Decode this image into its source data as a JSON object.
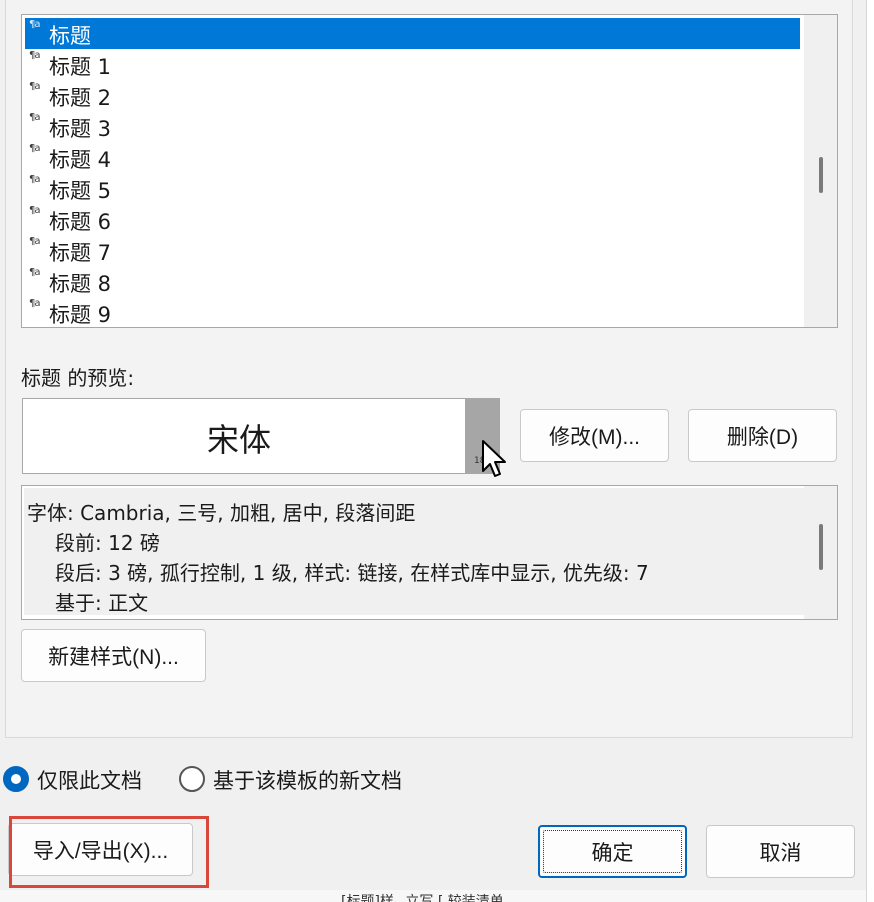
{
  "style_list": {
    "items": [
      {
        "label": "标题",
        "selected": true
      },
      {
        "label": "标题 1",
        "selected": false
      },
      {
        "label": "标题 2",
        "selected": false
      },
      {
        "label": "标题 3",
        "selected": false
      },
      {
        "label": "标题 4",
        "selected": false
      },
      {
        "label": "标题 5",
        "selected": false
      },
      {
        "label": "标题 6",
        "selected": false
      },
      {
        "label": "标题 7",
        "selected": false
      },
      {
        "label": "标题 8",
        "selected": false
      },
      {
        "label": "标题 9",
        "selected": false
      }
    ],
    "item_icon": "paragraph-style-icon",
    "para_mark": "¶a"
  },
  "preview": {
    "label": "标题 的预览:",
    "font_sample": "宋体",
    "size_hint": "18"
  },
  "buttons": {
    "modify": "修改(M)...",
    "delete": "删除(D)",
    "new_style": "新建样式(N)...",
    "import_export": "导入/导出(X)...",
    "ok": "确定",
    "cancel": "取消"
  },
  "description": {
    "lines": [
      "字体: Cambria, 三号, 加粗, 居中, 段落间距",
      "段前: 12 磅",
      "段后: 3 磅, 孤行控制, 1 级, 样式: 链接, 在样式库中显示, 优先级: 7",
      "基于: 正文"
    ]
  },
  "radios": {
    "doc_only": {
      "label": "仅限此文档",
      "checked": true
    },
    "template": {
      "label": "基于该模板的新文档",
      "checked": false
    }
  },
  "colors": {
    "selection": "#0078d7",
    "accent": "#0067c0",
    "highlight_box": "#d9473a"
  },
  "bottom_bleed_text": "、_[标题]样_ 立写 [ 较装清单"
}
